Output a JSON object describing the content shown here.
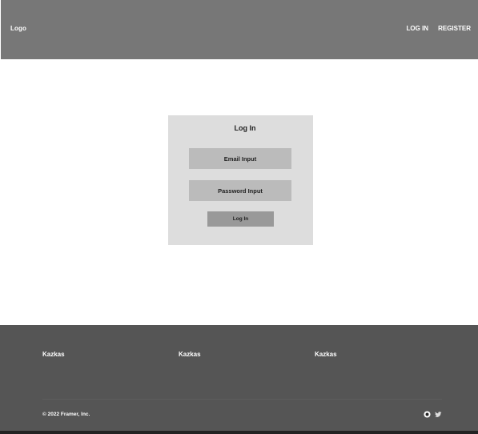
{
  "header": {
    "logo": "Logo",
    "nav": {
      "login": "LOG IN",
      "register": "REGISTER"
    }
  },
  "login_form": {
    "title": "Log In",
    "email_placeholder": "Email Input",
    "password_placeholder": "Password Input",
    "submit_label": "Log In"
  },
  "footer": {
    "columns": [
      "Kazkas",
      "Kazkas",
      "Kazkas"
    ],
    "copyright": "© 2022 Framer, Inc.",
    "social_icons": [
      "dribbble-icon",
      "twitter-icon"
    ]
  },
  "colors": {
    "header_bg": "#777777",
    "card_bg": "#dddddd",
    "input_bg": "#bbbbbb",
    "button_bg": "#999999",
    "footer_bg": "#555555"
  }
}
